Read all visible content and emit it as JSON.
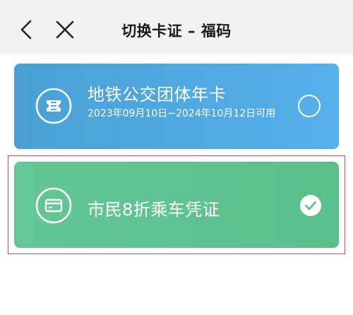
{
  "header": {
    "title": "切换卡证 – 福码",
    "back_icon": "chevron-left-icon",
    "close_icon": "close-icon"
  },
  "cards": [
    {
      "title": "地铁公交团体年卡",
      "subtitle": "2023年09月10日~2024年10月12日可用",
      "icon": "ticket-icon",
      "selected": false,
      "color": "#4fa8e2"
    },
    {
      "title": "市民8折乘车凭证",
      "icon": "card-icon",
      "selected": true,
      "color": "#60c490"
    }
  ],
  "colors": {
    "nav_bg": "#f2f2f2",
    "selection_frame": "#e14b4b"
  }
}
